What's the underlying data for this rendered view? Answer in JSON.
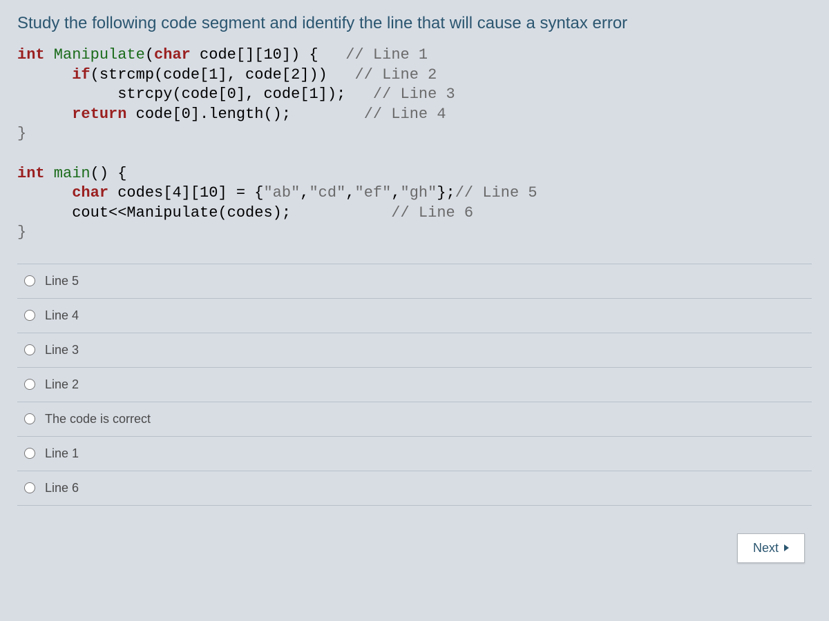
{
  "question": {
    "title": "Study the following code segment and identify the line that will cause a syntax error",
    "code": {
      "l1": {
        "kw1": "int",
        "fn": " Manipulate",
        "rest": "(",
        "kw2": "char",
        "rest2": " code[][10]) {",
        "cm": "   // Line 1"
      },
      "l2": {
        "kw": "if",
        "rest": "(strcmp(code[1], code[2]))",
        "cm": "   // Line 2"
      },
      "l3": {
        "rest": "strcpy(code[0], code[1]);",
        "cm": "   // Line 3"
      },
      "l4": {
        "kw": "return",
        "rest": " code[0].length();",
        "cm": "        // Line 4"
      },
      "l5": {
        "brace": "}"
      },
      "blank": "",
      "l6": {
        "kw": "int",
        "fn": " main",
        "rest": "() {"
      },
      "l7": {
        "kw": "char",
        "rest": " codes[4][10] = {",
        "s1": "\"ab\"",
        "c1": ",",
        "s2": "\"cd\"",
        "c2": ",",
        "s3": "\"ef\"",
        "c3": ",",
        "s4": "\"gh\"",
        "rest2": "};",
        "cm": "// Line 5"
      },
      "l8": {
        "rest": "cout<<Manipulate(codes);",
        "cm": "           // Line 6"
      },
      "l9": {
        "brace": "}"
      }
    }
  },
  "options": [
    {
      "label": "Line 5"
    },
    {
      "label": "Line 4"
    },
    {
      "label": "Line 3"
    },
    {
      "label": "Line 2"
    },
    {
      "label": "The code is correct"
    },
    {
      "label": "Line 1"
    },
    {
      "label": "Line 6"
    }
  ],
  "footer": {
    "next_label": "Next"
  }
}
